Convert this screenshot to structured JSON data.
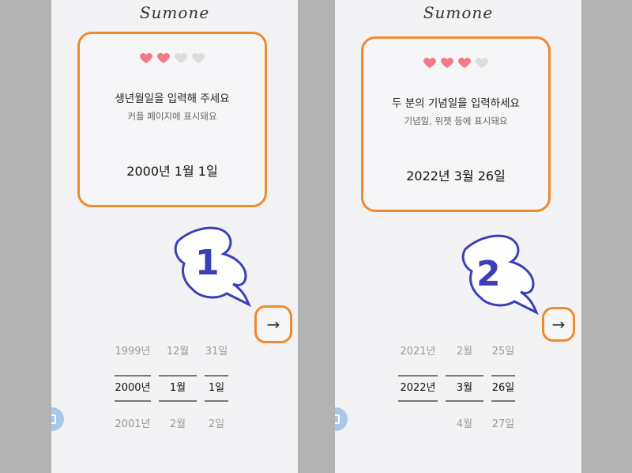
{
  "brand": "Sumone",
  "panels": [
    {
      "step": "1",
      "title": "생년월일을 입력해 주세요",
      "subtitle": "커플 페이지에 표시돼요",
      "date": "2000년 1월 1일",
      "hearts_filled": 2,
      "hearts_total": 4,
      "next": "→",
      "picker": {
        "year": [
          "1999년",
          "2000년",
          "2001년"
        ],
        "month": [
          "12월",
          "1월",
          "2월"
        ],
        "day": [
          "31일",
          "1일",
          "2일"
        ]
      }
    },
    {
      "step": "2",
      "title": "두 분의 기념일을 입력하세요",
      "subtitle": "기념일, 위젯 등에 표시돼요",
      "date": "2022년 3월 26일",
      "hearts_filled": 3,
      "hearts_total": 4,
      "next": "→",
      "picker": {
        "year": [
          "2021년",
          "2022년",
          ""
        ],
        "month": [
          "2월",
          "3월",
          "4월"
        ],
        "day": [
          "25일",
          "26일",
          "27일"
        ]
      }
    }
  ],
  "colors": {
    "highlight": "#f08a2c",
    "heart_filled": "#f07b86",
    "heart_empty": "#dcdcdc",
    "hand_number": "#3b3fb8"
  }
}
